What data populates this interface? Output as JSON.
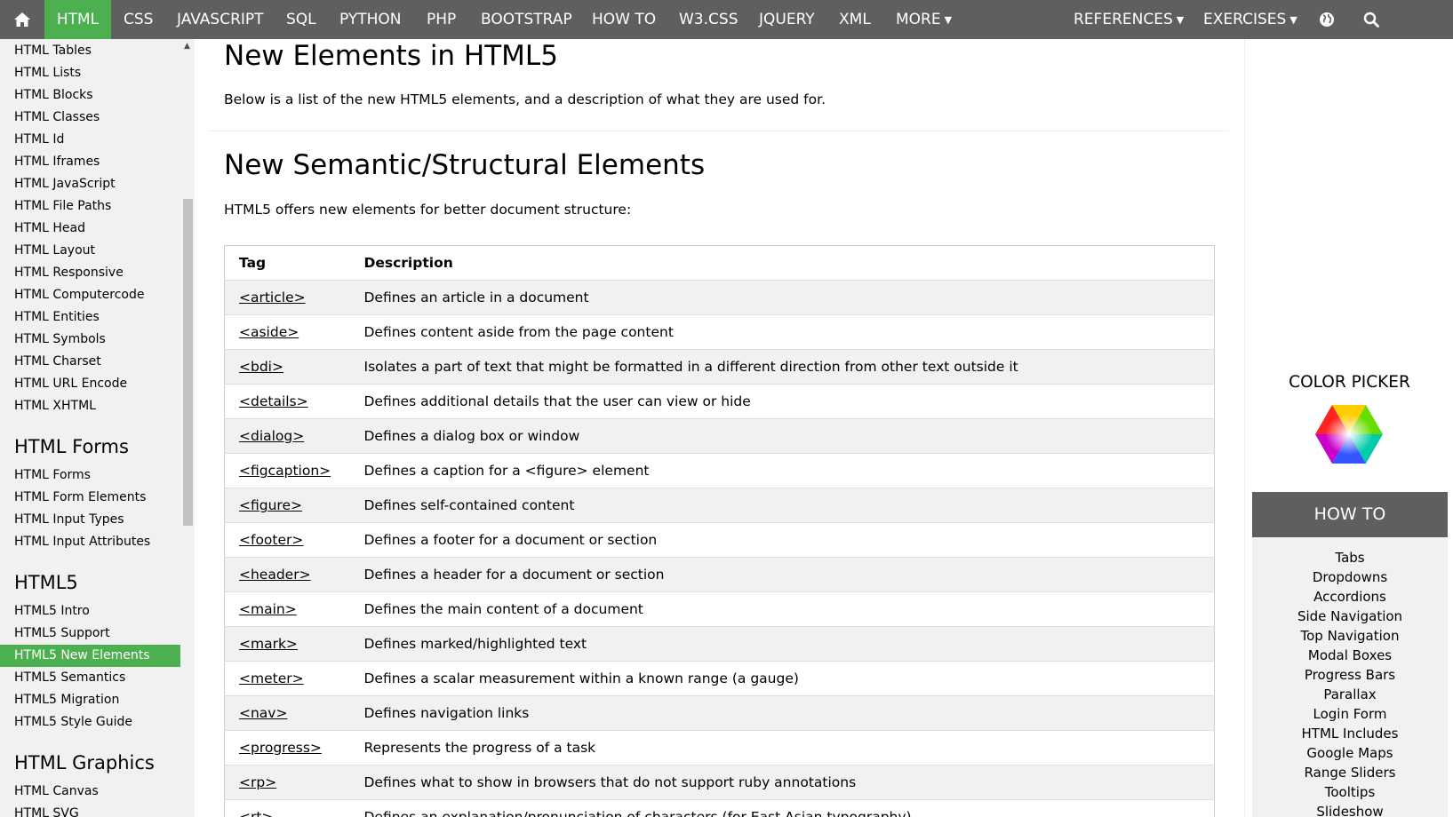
{
  "topnav": {
    "items": [
      "HTML",
      "CSS",
      "JAVASCRIPT",
      "SQL",
      "PYTHON",
      "PHP",
      "BOOTSTRAP",
      "HOW TO",
      "W3.CSS",
      "JQUERY",
      "XML"
    ],
    "more": "MORE",
    "references": "REFERENCES",
    "exercises": "EXERCISES",
    "active_item": "HTML",
    "icons": [
      "home-icon",
      "globe-icon",
      "search-icon"
    ],
    "colors": {
      "bar": "#5f5f5f",
      "active": "#4caf50"
    }
  },
  "sidebar": {
    "links_top": [
      "HTML Tables",
      "HTML Lists",
      "HTML Blocks",
      "HTML Classes",
      "HTML Id",
      "HTML Iframes",
      "HTML JavaScript",
      "HTML File Paths",
      "HTML Head",
      "HTML Layout",
      "HTML Responsive",
      "HTML Computercode",
      "HTML Entities",
      "HTML Symbols",
      "HTML Charset",
      "HTML URL Encode",
      "HTML XHTML"
    ],
    "heading_forms": "HTML Forms",
    "links_forms": [
      "HTML Forms",
      "HTML Form Elements",
      "HTML Input Types",
      "HTML Input Attributes"
    ],
    "heading_html5": "HTML5",
    "links_html5": [
      "HTML5 Intro",
      "HTML5 Support",
      "HTML5 New Elements",
      "HTML5 Semantics",
      "HTML5 Migration",
      "HTML5 Style Guide"
    ],
    "active_link": "HTML5 New Elements",
    "heading_graphics": "HTML Graphics",
    "links_graphics": [
      "HTML Canvas",
      "HTML SVG"
    ]
  },
  "main": {
    "title": "New Elements in HTML5",
    "intro": "Below is a list of the new HTML5 elements, and a description of what they are used for.",
    "section_title": "New Semantic/Structural Elements",
    "section_intro": "HTML5 offers new elements for better document structure:",
    "table": {
      "headers": [
        "Tag",
        "Description"
      ],
      "rows": [
        [
          "<article>",
          "Defines an article in a document"
        ],
        [
          "<aside>",
          "Defines content aside from the page content"
        ],
        [
          "<bdi>",
          "Isolates a part of text that might be formatted in a different direction from other text outside it"
        ],
        [
          "<details>",
          "Defines additional details that the user can view or hide"
        ],
        [
          "<dialog>",
          "Defines a dialog box or window"
        ],
        [
          "<figcaption>",
          "Defines a caption for a <figure> element"
        ],
        [
          "<figure>",
          "Defines self-contained content"
        ],
        [
          "<footer>",
          "Defines a footer for a document or section"
        ],
        [
          "<header>",
          "Defines a header for a document or section"
        ],
        [
          "<main>",
          "Defines the main content of a document"
        ],
        [
          "<mark>",
          "Defines marked/highlighted text"
        ],
        [
          "<meter>",
          "Defines a scalar measurement within a known range (a gauge)"
        ],
        [
          "<nav>",
          "Defines navigation links"
        ],
        [
          "<progress>",
          "Represents the progress of a task"
        ],
        [
          "<rp>",
          "Defines what to show in browsers that do not support ruby annotations"
        ],
        [
          "<rt>",
          "Defines an explanation/pronunciation of characters (for East Asian typography)"
        ]
      ]
    }
  },
  "right": {
    "color_picker_title": "COLOR PICKER",
    "color_picker_icon": "color-hexagon-icon",
    "howto_title": "HOW TO",
    "howto_links": [
      "Tabs",
      "Dropdowns",
      "Accordions",
      "Side Navigation",
      "Top Navigation",
      "Modal Boxes",
      "Progress Bars",
      "Parallax",
      "Login Form",
      "HTML Includes",
      "Google Maps",
      "Range Sliders",
      "Tooltips",
      "Slideshow"
    ]
  }
}
